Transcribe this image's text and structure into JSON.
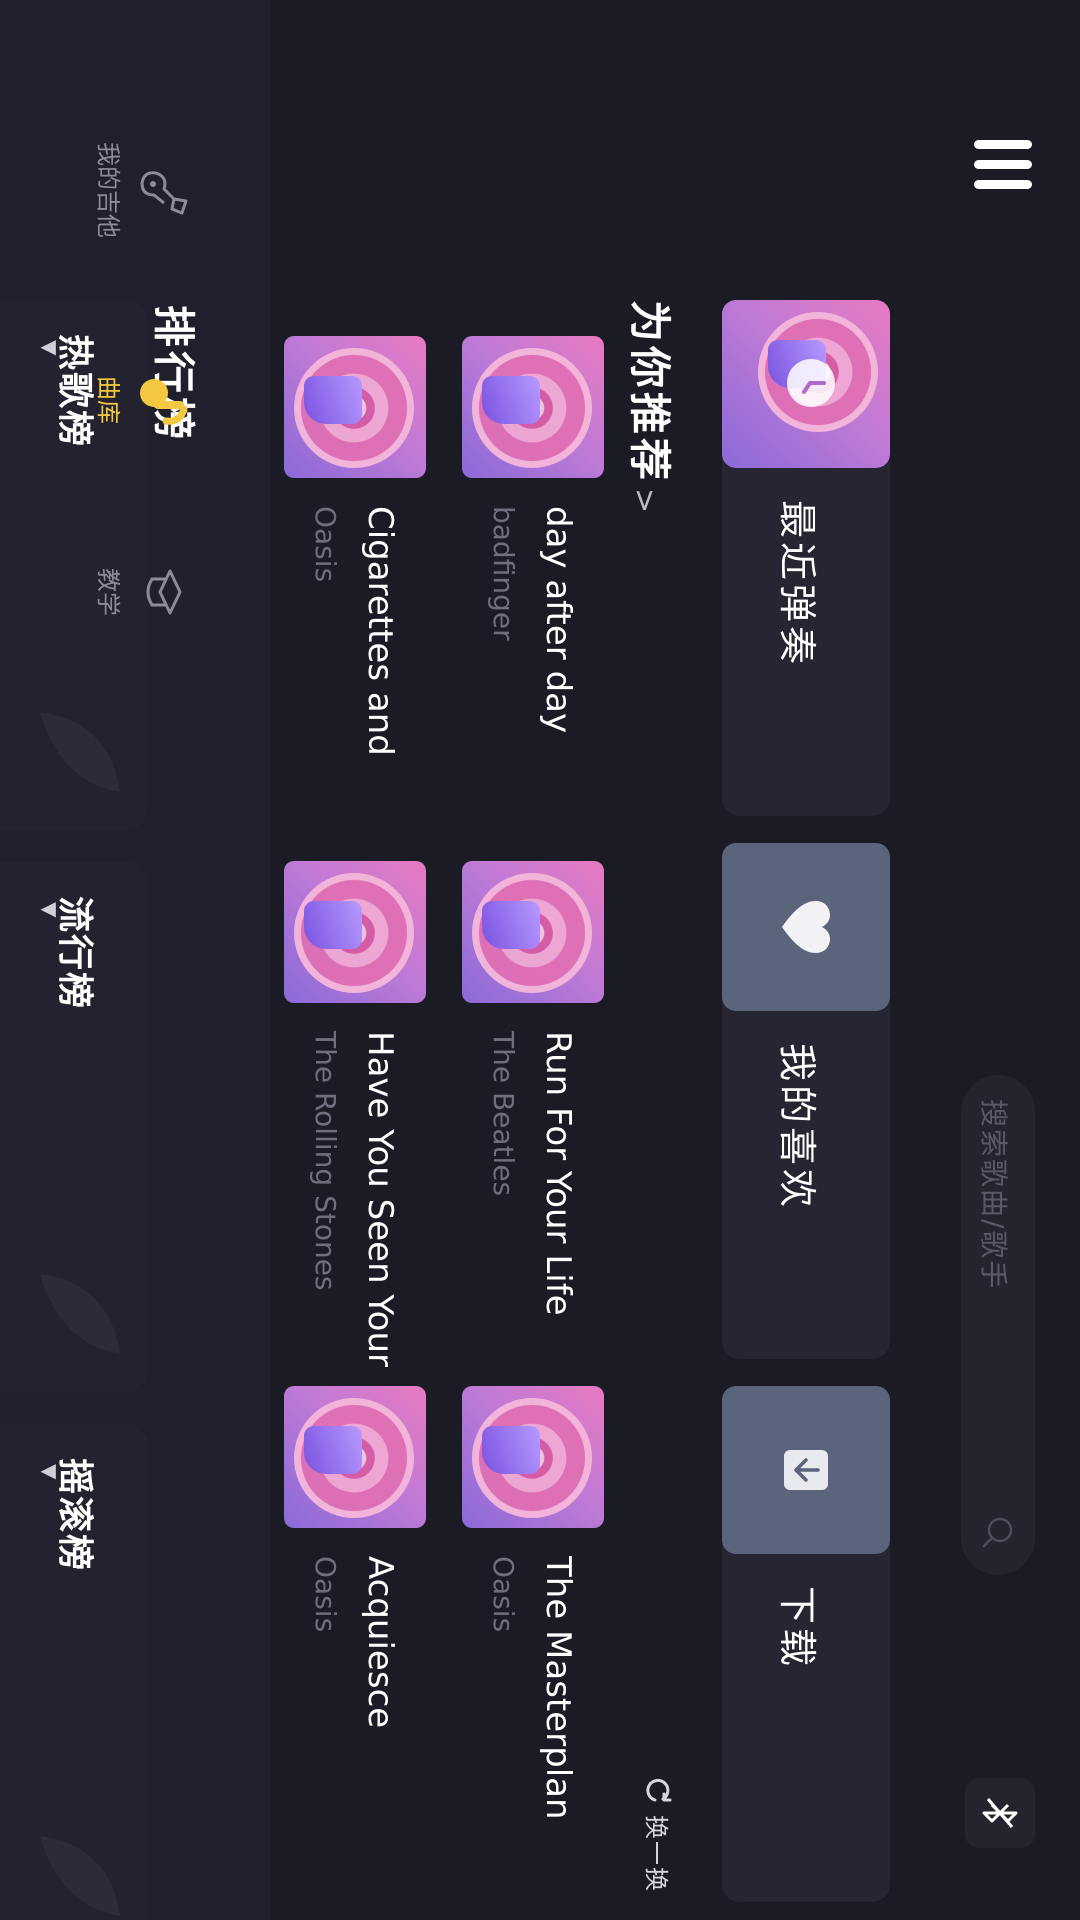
{
  "nav": {
    "items": [
      {
        "label": "我的吉他",
        "icon": "guitar-icon"
      },
      {
        "label": "曲库",
        "icon": "music-note-icon",
        "active": true
      },
      {
        "label": "教学",
        "icon": "teaching-hat-icon"
      }
    ],
    "menu_icon": "menu-icon"
  },
  "search": {
    "placeholder": "搜索歌曲/歌手"
  },
  "quick": [
    {
      "label": "最近弹奏",
      "icon": "clock-icon"
    },
    {
      "label": "我的喜欢",
      "icon": "heart-icon"
    },
    {
      "label": "下载",
      "icon": "download-icon"
    }
  ],
  "recommend": {
    "title": "为你推荐",
    "more": ">",
    "refresh_label": "换一换",
    "songs": [
      {
        "title": "day after day",
        "artist": "badfinger"
      },
      {
        "title": "Run For Your Life",
        "artist": "The Beatles"
      },
      {
        "title": "The Masterplan",
        "artist": "Oasis"
      },
      {
        "title": "Cigarettes and",
        "artist": "Oasis"
      },
      {
        "title": "Have You Seen Your",
        "artist": "The Rolling Stones"
      },
      {
        "title": "Acquiesce",
        "artist": "Oasis"
      }
    ]
  },
  "rankings": {
    "title": "排行榜",
    "charts": [
      {
        "label": "热歌榜"
      },
      {
        "label": "流行榜"
      },
      {
        "label": "摇滚榜"
      }
    ]
  },
  "colors": {
    "accent": "#f5c842",
    "background": "#1b1b26",
    "card": "#262633",
    "purple": "#8c62d8"
  }
}
